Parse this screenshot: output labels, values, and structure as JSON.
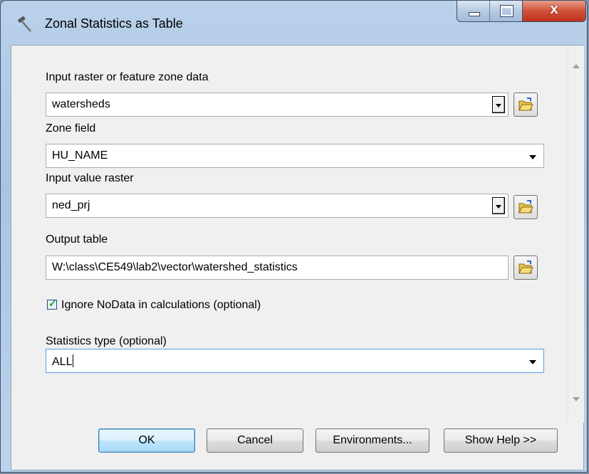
{
  "window": {
    "title": "Zonal Statistics as Table"
  },
  "titlebar": {
    "close_glyph": "x"
  },
  "form": {
    "input_zone": {
      "label": "Input raster or feature zone data",
      "value": "watersheds"
    },
    "zone_field": {
      "label": "Zone field",
      "value": "HU_NAME"
    },
    "input_value": {
      "label": "Input value raster",
      "value": "ned_prj"
    },
    "output_table": {
      "label": "Output table",
      "value": "W:\\class\\CE549\\lab2\\vector\\watershed_statistics"
    },
    "ignore_nodata": {
      "label": "Ignore NoData in calculations (optional)",
      "checked": true
    },
    "stats_type": {
      "label": "Statistics type (optional)",
      "value": "ALL"
    }
  },
  "buttons": {
    "ok": "OK",
    "cancel": "Cancel",
    "environments": "Environments...",
    "help": "Show Help >>"
  },
  "icons": [
    "hammer-icon",
    "folder-open-icon",
    "checkmark-icon",
    "dropdown-arrow-icon"
  ],
  "colors": {
    "title_bar": "#b9d1ea",
    "close_button": "#c7361e",
    "default_button_border": "#3c7fb1",
    "checkmark": "#21a121"
  }
}
